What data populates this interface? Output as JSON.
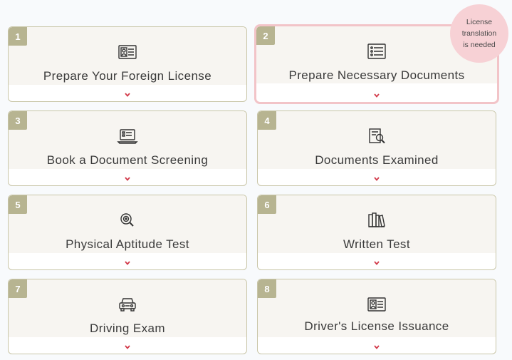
{
  "steps": [
    {
      "number": "1",
      "label": "Prepare Your Foreign License",
      "icon": "license-card-icon"
    },
    {
      "number": "2",
      "label": "Prepare Necessary Documents",
      "icon": "checklist-icon"
    },
    {
      "number": "3",
      "label": "Book a Document Screening",
      "icon": "laptop-icon"
    },
    {
      "number": "4",
      "label": "Documents Examined",
      "icon": "document-magnifier-icon"
    },
    {
      "number": "5",
      "label": "Physical Aptitude Test",
      "icon": "eye-test-icon"
    },
    {
      "number": "6",
      "label": "Written Test",
      "icon": "books-icon"
    },
    {
      "number": "7",
      "label": "Driving Exam",
      "icon": "car-icon"
    },
    {
      "number": "8",
      "label": "Driver's License Issuance",
      "icon": "license-card-icon"
    }
  ],
  "callout": {
    "text": "License\ntranslation\nis needed"
  },
  "colors": {
    "number_badge": "#b7b491",
    "card_border": "#c9c6a8",
    "highlight_border": "#f2c4c8",
    "chevron": "#d23a4a",
    "callout_bg": "#f7d1d5"
  }
}
